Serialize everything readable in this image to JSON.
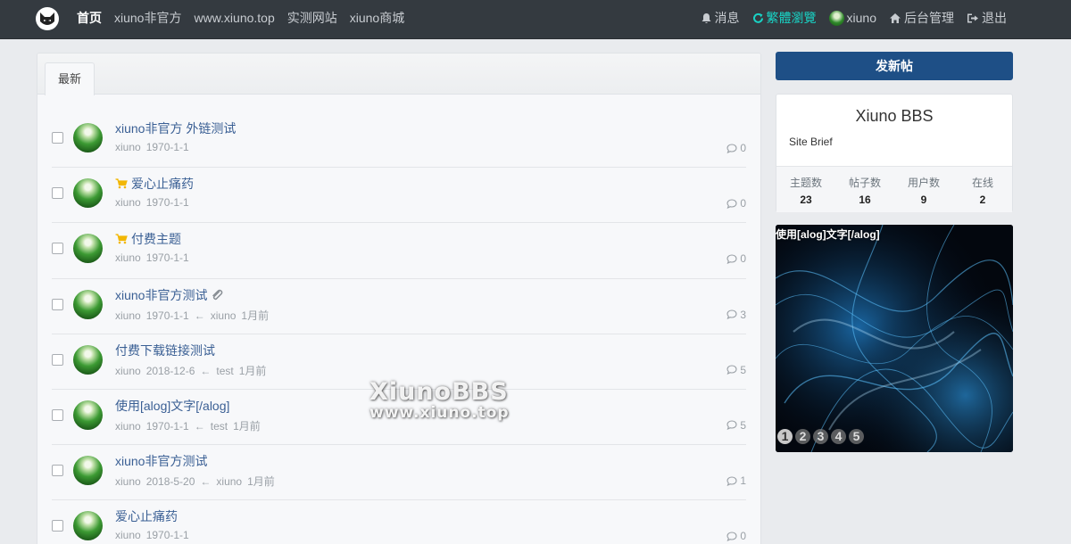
{
  "nav": {
    "logo_icon": "cat-head-icon",
    "left": [
      {
        "label": "首页",
        "active": true
      },
      {
        "label": "xiuno非官方"
      },
      {
        "label": "www.xiuno.top"
      },
      {
        "label": "实测网站"
      },
      {
        "label": "xiuno商城"
      }
    ],
    "right": {
      "messages": "消息",
      "traditional": "繁體瀏覽",
      "username": "xiuno",
      "admin": "后台管理",
      "logout": "退出"
    },
    "highlight_color": "#19d3c5"
  },
  "main": {
    "tab_label": "最新",
    "threads": [
      {
        "title": "xiuno非官方 外链测试",
        "author": "xiuno",
        "date": "1970-1-1",
        "last_user": "",
        "last_time": "",
        "replies": "0",
        "cart": false,
        "attach": false
      },
      {
        "title": "爱心止痛药",
        "author": "xiuno",
        "date": "1970-1-1",
        "last_user": "",
        "last_time": "",
        "replies": "0",
        "cart": true,
        "attach": false
      },
      {
        "title": "付费主题",
        "author": "xiuno",
        "date": "1970-1-1",
        "last_user": "",
        "last_time": "",
        "replies": "0",
        "cart": true,
        "attach": false
      },
      {
        "title": "xiuno非官方测试",
        "author": "xiuno",
        "date": "1970-1-1",
        "last_user": "xiuno",
        "last_time": "1月前",
        "replies": "3",
        "cart": false,
        "attach": true
      },
      {
        "title": "付费下载链接测试",
        "author": "xiuno",
        "date": "2018-12-6",
        "last_user": "test",
        "last_time": "1月前",
        "replies": "5",
        "cart": false,
        "attach": false
      },
      {
        "title": "使用[alog]文字[/alog]",
        "author": "xiuno",
        "date": "1970-1-1",
        "last_user": "test",
        "last_time": "1月前",
        "replies": "5",
        "cart": false,
        "attach": false
      },
      {
        "title": "xiuno非官方测试",
        "author": "xiuno",
        "date": "2018-5-20",
        "last_user": "xiuno",
        "last_time": "1月前",
        "replies": "1",
        "cart": false,
        "attach": false
      },
      {
        "title": "爱心止痛药",
        "author": "xiuno",
        "date": "1970-1-1",
        "last_user": "",
        "last_time": "",
        "replies": "0",
        "cart": false,
        "attach": false
      }
    ],
    "arrow": "←"
  },
  "sidebar": {
    "post_button": "发新帖",
    "site_name": "Xiuno BBS",
    "site_brief": "Site Brief",
    "stats": [
      {
        "label": "主题数",
        "value": "23"
      },
      {
        "label": "帖子数",
        "value": "16"
      },
      {
        "label": "用户数",
        "value": "9"
      },
      {
        "label": "在线",
        "value": "2"
      }
    ],
    "banner_caption": "使用[alog]文字[/alog]",
    "banner_pages": [
      "1",
      "2",
      "3",
      "4",
      "5"
    ],
    "accent_color": "#1e4f86"
  },
  "watermark": {
    "line1": "XiunoBBS",
    "line2": "www.xiuno.top"
  }
}
